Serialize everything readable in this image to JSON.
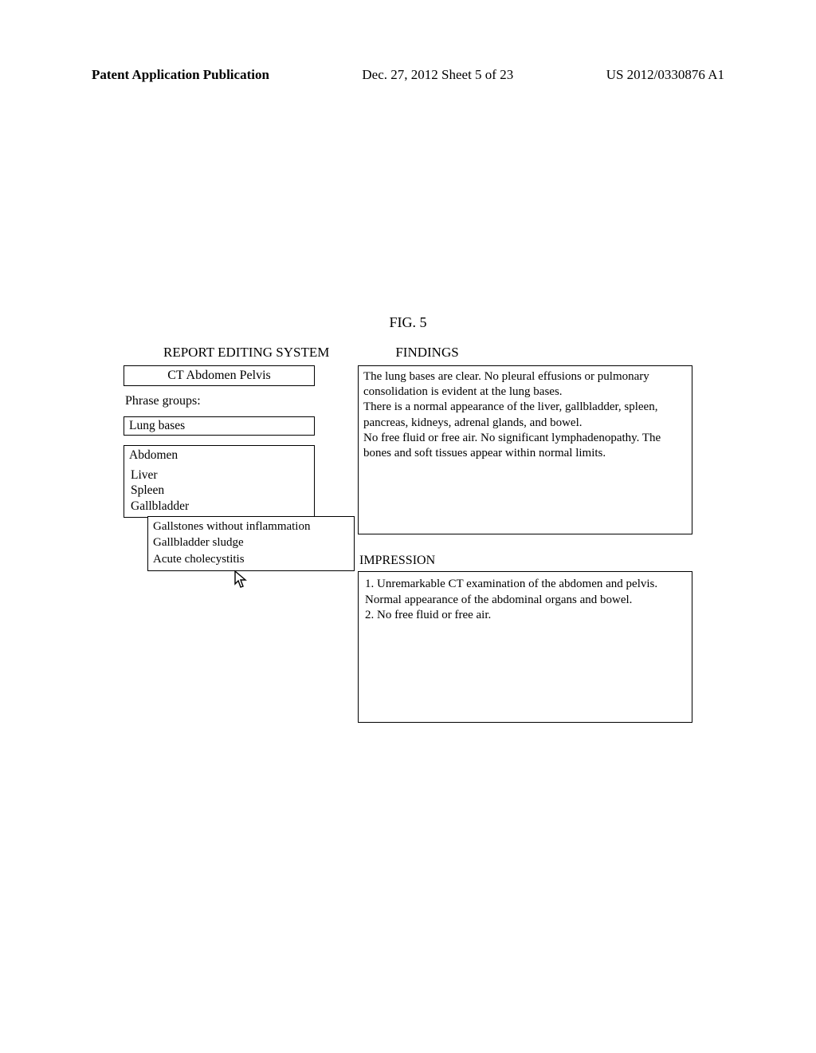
{
  "header": {
    "left": "Patent Application Publication",
    "center": "Dec. 27, 2012  Sheet 5 of 23",
    "right": "US 2012/0330876 A1"
  },
  "figure_label": "FIG. 5",
  "section_titles": {
    "report_editing": "REPORT EDITING SYSTEM",
    "findings": "FINDINGS",
    "impression": "IMPRESSION"
  },
  "left_panel": {
    "template_name": "CT Abdomen Pelvis",
    "phrase_groups_label": "Phrase groups:",
    "group_lung": "Lung bases",
    "group_abdomen": "Abdomen",
    "abdomen_children": {
      "liver": "Liver",
      "spleen": "Spleen",
      "gallbladder": "Gallbladder"
    },
    "gallbladder_options": {
      "opt1": "Gallstones without inflammation",
      "opt2": "Gallbladder sludge",
      "opt3": "Acute cholecystitis"
    }
  },
  "findings_text": {
    "p1": "The lung bases are clear. No pleural effusions or pulmonary consolidation is evident at the lung bases.",
    "p2": "There is a normal appearance of the liver, gallbladder, spleen, pancreas, kidneys, adrenal glands, and bowel.",
    "p3": "No free fluid or free air. No significant lymphadenopathy. The bones and soft tissues appear within normal limits."
  },
  "impression_text": {
    "li1": "1. Unremarkable CT examination of the abdomen and pelvis. Normal appearance of the abdominal organs and bowel.",
    "li2": "2.    No free fluid or free air."
  }
}
